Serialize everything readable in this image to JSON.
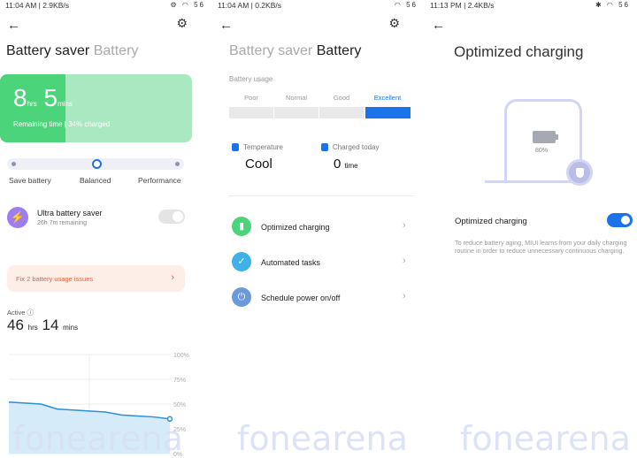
{
  "panel1": {
    "status_time": "11:04 AM | 2.9KB/s",
    "status_icons": "⚙ ◠ 56",
    "title_active": "Battery saver",
    "title_inactive": "Battery",
    "remaining_hours": "8",
    "hrs_unit": "hrs",
    "remaining_mins": "5",
    "mins_unit": "mins",
    "remaining_text": "Remaining time | 34% charged",
    "charge_fraction": 0.34,
    "modes": [
      "Save battery",
      "Balanced",
      "Performance"
    ],
    "ultra_title": "Ultra battery saver",
    "ultra_sub": "26h 7m remaining",
    "warning": "Fix 2 battery usage issues",
    "active_label": "Active",
    "active_hours": "46",
    "active_hours_unit": "hrs",
    "active_mins": "14",
    "active_mins_unit": "mins",
    "chart_data": {
      "type": "area",
      "title": "",
      "xlabel": "",
      "ylabel": "",
      "yticks": [
        "100%",
        "75%",
        "50%",
        "25%",
        "0%"
      ],
      "x": [
        0,
        1,
        2,
        3,
        4,
        5,
        6,
        7,
        8,
        9,
        10
      ],
      "values": [
        52,
        51,
        50,
        45,
        44,
        43,
        42,
        39,
        38,
        37,
        35
      ],
      "ylim": [
        0,
        100
      ],
      "grid": true,
      "color": "#2a90d9"
    }
  },
  "panel2": {
    "status_time": "11:04 AM | 0.2KB/s",
    "status_icons": "◠ 56",
    "title_inactive": "Battery saver",
    "title_active": "Battery",
    "usage_label": "Battery usage",
    "levels": [
      "Poor",
      "Normal",
      "Good",
      "Excellent"
    ],
    "selected_level": "Excellent",
    "temp_label": "Temperature",
    "temp_value": "Cool",
    "charged_label": "Charged today",
    "charged_value": "0",
    "charged_unit": "time",
    "rows": [
      "Optimized charging",
      "Automated tasks",
      "Schedule power on/off"
    ]
  },
  "panel3": {
    "status_time": "11:13 PM | 2.4KB/s",
    "status_icons": "✱ ◠ 56",
    "title": "Optimized charging",
    "battery_pct": "80%",
    "setting_label": "Optimized charging",
    "setting_on": true,
    "description": "To reduce battery aging, MIUI learns from your daily charging routine in order to reduce unnecessary continuous charging."
  },
  "watermark": "fonearena",
  "colors": {
    "accent": "#1a73e8",
    "green": "#4bd47a",
    "warn": "#e06540"
  }
}
